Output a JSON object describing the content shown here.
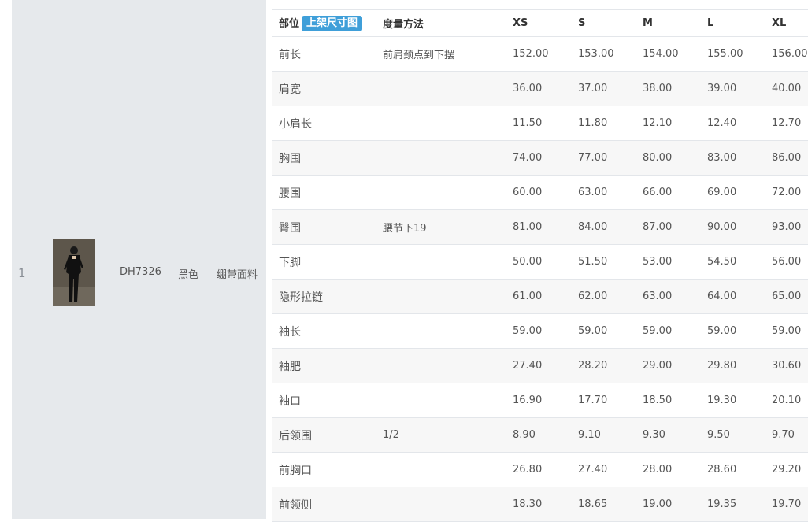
{
  "row": {
    "index": "1",
    "style_code": "DH7326",
    "color": "黑色",
    "fabric": "绷带面料"
  },
  "size_table": {
    "header": {
      "part": "部位",
      "badge": "上架尺寸图",
      "method": "度量方法",
      "sizes": [
        "XS",
        "S",
        "M",
        "L",
        "XL"
      ]
    },
    "rows": [
      {
        "part": "前长",
        "method": "前肩颈点到下摆",
        "values": [
          "152.00",
          "153.00",
          "154.00",
          "155.00",
          "156.00"
        ]
      },
      {
        "part": "肩宽",
        "method": "",
        "values": [
          "36.00",
          "37.00",
          "38.00",
          "39.00",
          "40.00"
        ]
      },
      {
        "part": "小肩长",
        "method": "",
        "values": [
          "11.50",
          "11.80",
          "12.10",
          "12.40",
          "12.70"
        ]
      },
      {
        "part": "胸围",
        "method": "",
        "values": [
          "74.00",
          "77.00",
          "80.00",
          "83.00",
          "86.00"
        ]
      },
      {
        "part": "腰围",
        "method": "",
        "values": [
          "60.00",
          "63.00",
          "66.00",
          "69.00",
          "72.00"
        ]
      },
      {
        "part": "臀围",
        "method": "腰节下19",
        "values": [
          "81.00",
          "84.00",
          "87.00",
          "90.00",
          "93.00"
        ]
      },
      {
        "part": "下脚",
        "method": "",
        "values": [
          "50.00",
          "51.50",
          "53.00",
          "54.50",
          "56.00"
        ]
      },
      {
        "part": "隐形拉链",
        "method": "",
        "values": [
          "61.00",
          "62.00",
          "63.00",
          "64.00",
          "65.00"
        ]
      },
      {
        "part": "袖长",
        "method": "",
        "values": [
          "59.00",
          "59.00",
          "59.00",
          "59.00",
          "59.00"
        ]
      },
      {
        "part": "袖肥",
        "method": "",
        "values": [
          "27.40",
          "28.20",
          "29.00",
          "29.80",
          "30.60"
        ]
      },
      {
        "part": "袖口",
        "method": "",
        "values": [
          "16.90",
          "17.70",
          "18.50",
          "19.30",
          "20.10"
        ]
      },
      {
        "part": "后领围",
        "method": "1/2",
        "values": [
          "8.90",
          "9.10",
          "9.30",
          "9.50",
          "9.70"
        ]
      },
      {
        "part": "前胸口",
        "method": "",
        "values": [
          "26.80",
          "27.40",
          "28.00",
          "28.60",
          "29.20"
        ]
      },
      {
        "part": "前领侧",
        "method": "",
        "values": [
          "18.30",
          "18.65",
          "19.00",
          "19.35",
          "19.70"
        ]
      }
    ]
  },
  "colors": {
    "left_panel": "#e6e9ec",
    "badge": "#3f9fd9",
    "row_stripe": "#f7f7f7",
    "border": "#e3e6ea"
  }
}
